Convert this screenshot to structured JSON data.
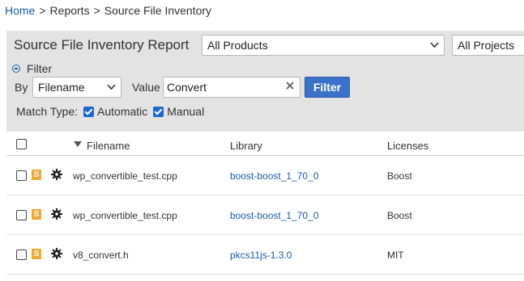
{
  "breadcrumb": {
    "home": "Home",
    "separator": ">",
    "reports": "Reports",
    "current": "Source File Inventory"
  },
  "report": {
    "title": "Source File Inventory Report",
    "product_select": "All Products",
    "project_select": "All Projects"
  },
  "filter": {
    "toggle_label": "Filter",
    "by_label": "By",
    "by_value": "Filename",
    "value_label": "Value",
    "value_input": "Convert",
    "button_label": "Filter",
    "match_type_label": "Match Type:",
    "automatic_label": "Automatic",
    "manual_label": "Manual",
    "automatic_checked": true,
    "manual_checked": true
  },
  "table": {
    "columns": {
      "filename": "Filename",
      "library": "Library",
      "licenses": "Licenses"
    },
    "sort_column": "Filename",
    "badge_letter": "S",
    "rows": [
      {
        "filename": "wp_convertible_test.cpp",
        "library": "boost-boost_1_70_0",
        "license": "Boost"
      },
      {
        "filename": "wp_convertible_test.cpp",
        "library": "boost-boost_1_70_0",
        "license": "Boost"
      },
      {
        "filename": "v8_convert.h",
        "library": "pkcs11js-1.3.0",
        "license": "MIT"
      }
    ]
  },
  "colors": {
    "link": "#1a5aa8",
    "filter_button": "#3a72c9",
    "panel_bg": "#e3e3e3",
    "badge": "#f0a830"
  }
}
